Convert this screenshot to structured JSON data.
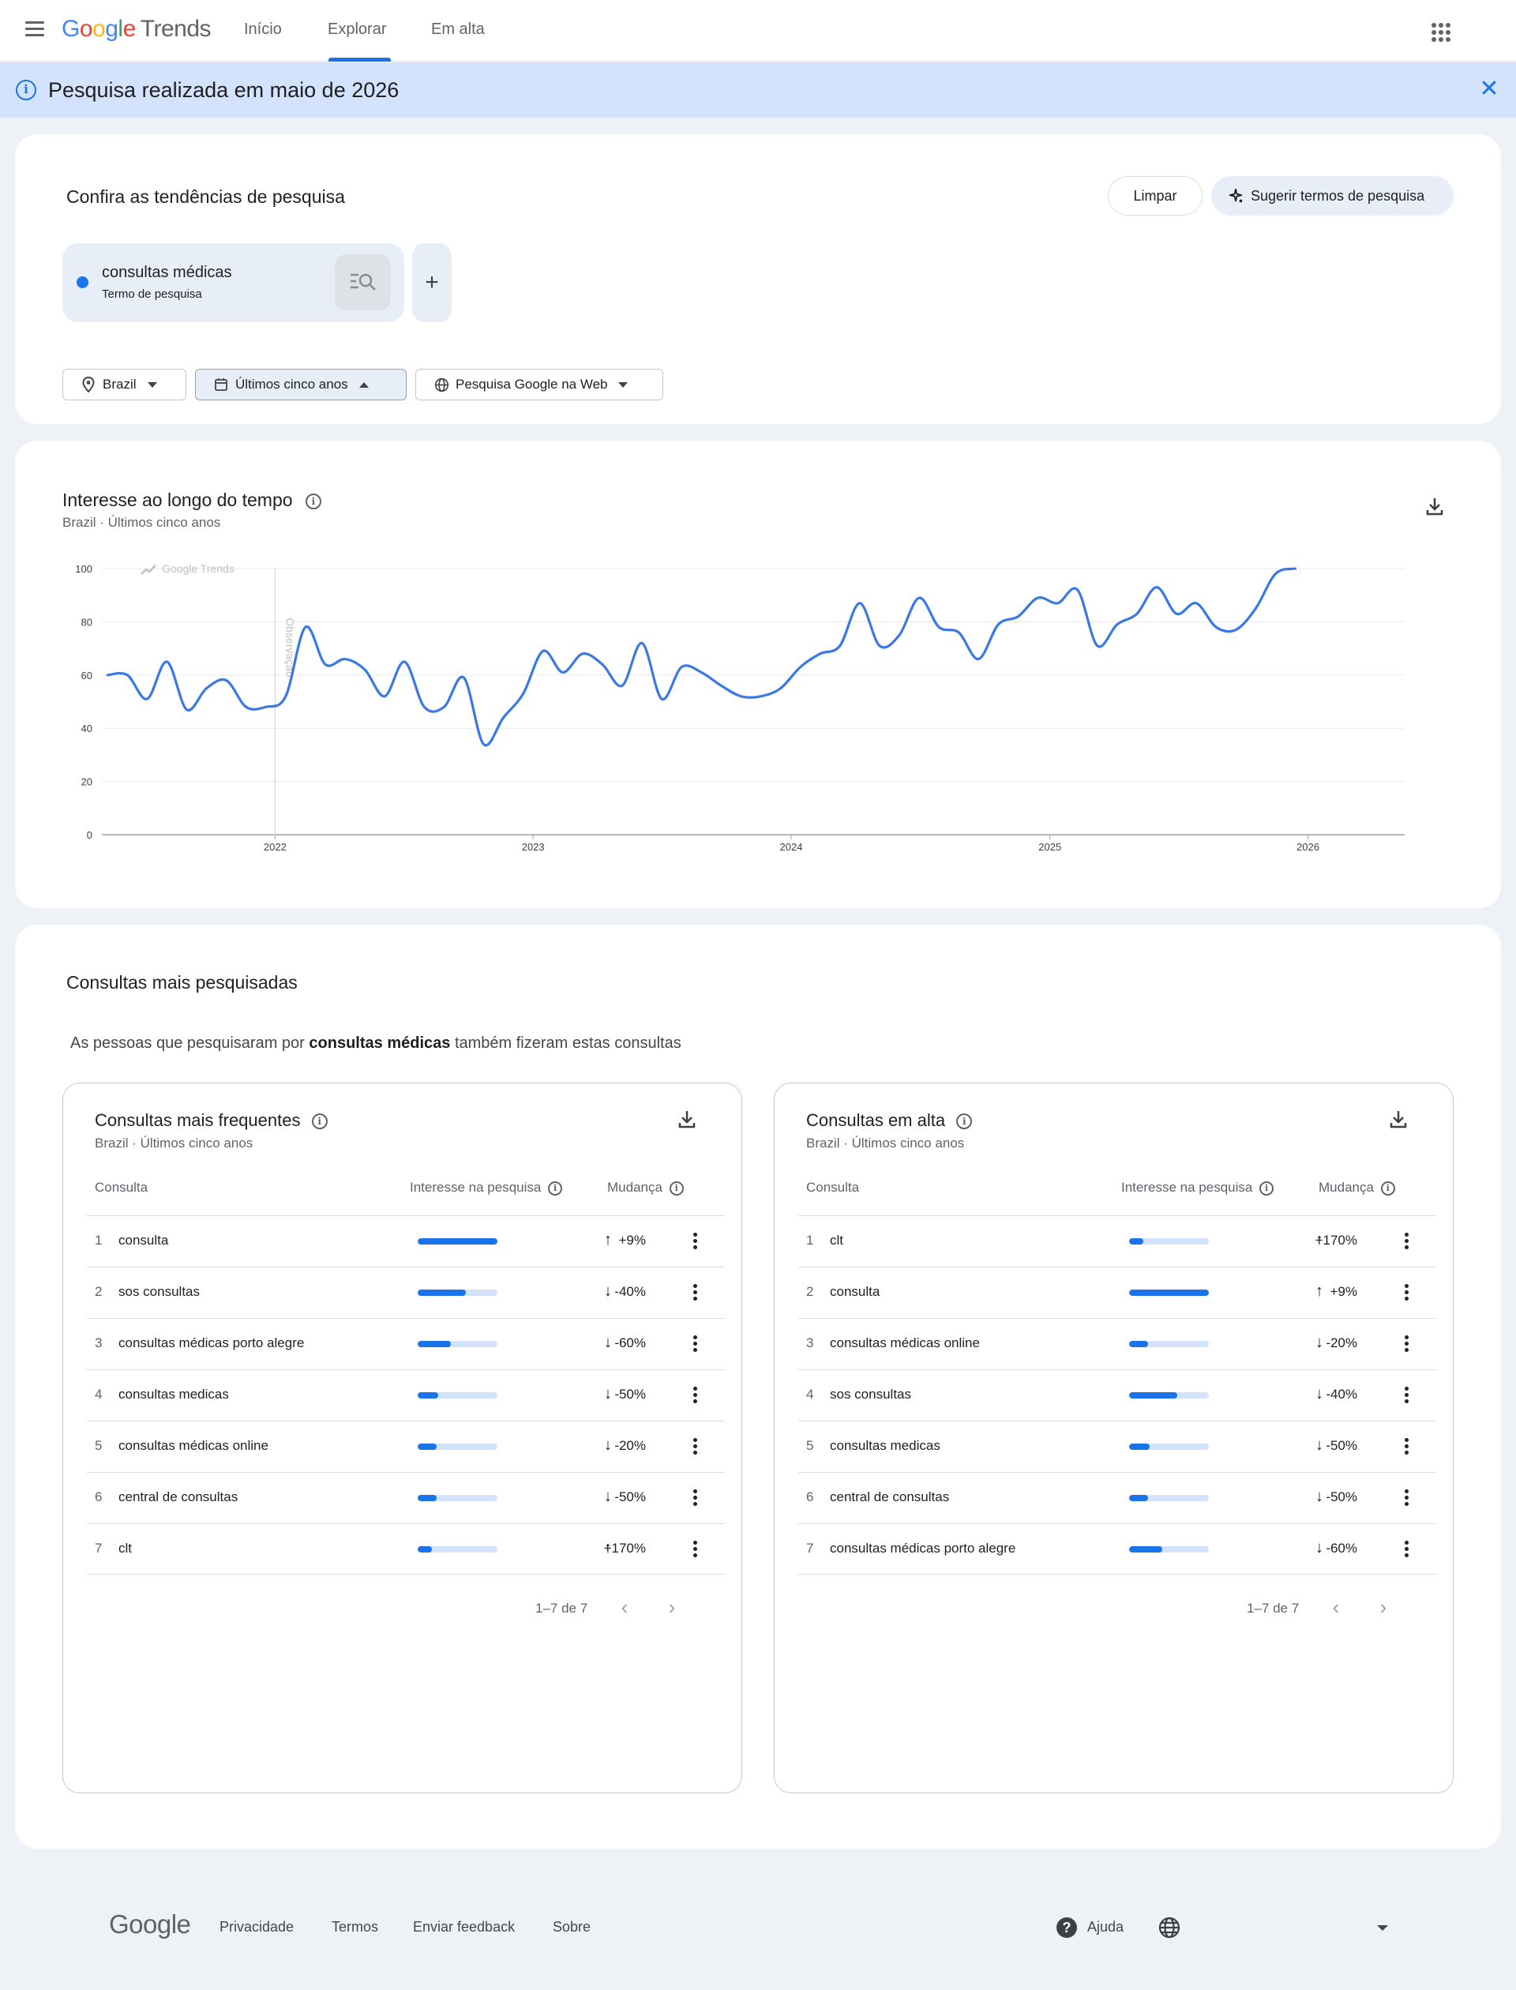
{
  "app": {
    "logo_google": [
      "G",
      "o",
      "o",
      "g",
      "l",
      "e"
    ],
    "logo_trends": "Trends",
    "nav": [
      {
        "label": "Início"
      },
      {
        "label": "Explorar"
      },
      {
        "label": "Em alta"
      }
    ]
  },
  "banner": {
    "text": "Pesquisa realizada em maio de 2026",
    "close": "✕"
  },
  "compare": {
    "title": "Confira as tendências de pesquisa",
    "clear_label": "Limpar",
    "suggest_label": "Sugerir termos de pesquisa",
    "term": {
      "name": "consultas médicas",
      "type": "Termo de pesquisa",
      "color": "#1a73e8"
    },
    "add_label": "+",
    "filters": {
      "location": "Brazil",
      "time": "Últimos cinco anos",
      "property": "Pesquisa Google na Web"
    }
  },
  "interest": {
    "title": "Interesse ao longo do tempo",
    "sub_location": "Brazil",
    "sub_time": "Últimos cinco anos",
    "watermark": "Google Trends",
    "note_label": "Observação"
  },
  "chart_data": {
    "type": "line",
    "title": "Interesse ao longo do tempo",
    "xlabel": "",
    "ylabel": "",
    "ylim": [
      0,
      100
    ],
    "yticks": [
      "0",
      "20",
      "40",
      "60",
      "80",
      "100"
    ],
    "xticks": [
      "2022",
      "2023",
      "2024",
      "2025",
      "2026"
    ],
    "xrange": [
      "2021-05",
      "2026-05"
    ],
    "grid": true,
    "series": [
      {
        "name": "consultas médicas",
        "color": "#3b78e7",
        "points": [
          [
            "2021-05-09",
            60
          ],
          [
            "2021-06-06",
            60
          ],
          [
            "2021-07-04",
            51
          ],
          [
            "2021-08-01",
            65
          ],
          [
            "2021-08-29",
            47
          ],
          [
            "2021-09-26",
            55
          ],
          [
            "2021-10-24",
            58
          ],
          [
            "2021-11-21",
            48
          ],
          [
            "2021-12-19",
            48
          ],
          [
            "2022-01-16",
            52
          ],
          [
            "2022-02-13",
            78
          ],
          [
            "2022-03-13",
            64
          ],
          [
            "2022-04-10",
            66
          ],
          [
            "2022-05-08",
            62
          ],
          [
            "2022-06-05",
            52
          ],
          [
            "2022-07-03",
            65
          ],
          [
            "2022-07-31",
            48
          ],
          [
            "2022-08-28",
            48
          ],
          [
            "2022-09-25",
            59
          ],
          [
            "2022-10-23",
            34
          ],
          [
            "2022-11-20",
            44
          ],
          [
            "2022-12-18",
            53
          ],
          [
            "2023-01-15",
            69
          ],
          [
            "2023-02-12",
            61
          ],
          [
            "2023-03-12",
            68
          ],
          [
            "2023-04-09",
            64
          ],
          [
            "2023-05-07",
            56
          ],
          [
            "2023-06-04",
            72
          ],
          [
            "2023-07-02",
            51
          ],
          [
            "2023-07-30",
            63
          ],
          [
            "2023-08-27",
            61
          ],
          [
            "2023-09-24",
            56
          ],
          [
            "2023-10-22",
            52
          ],
          [
            "2023-11-19",
            52
          ],
          [
            "2023-12-17",
            55
          ],
          [
            "2024-01-14",
            63
          ],
          [
            "2024-02-11",
            68
          ],
          [
            "2024-03-10",
            71
          ],
          [
            "2024-04-07",
            87
          ],
          [
            "2024-05-05",
            71
          ],
          [
            "2024-06-02",
            75
          ],
          [
            "2024-06-30",
            89
          ],
          [
            "2024-07-28",
            78
          ],
          [
            "2024-08-25",
            76
          ],
          [
            "2024-09-22",
            66
          ],
          [
            "2024-10-20",
            79
          ],
          [
            "2024-11-17",
            82
          ],
          [
            "2024-12-15",
            89
          ],
          [
            "2025-01-12",
            87
          ],
          [
            "2025-02-09",
            92
          ],
          [
            "2025-03-09",
            71
          ],
          [
            "2025-04-06",
            79
          ],
          [
            "2025-05-04",
            83
          ],
          [
            "2025-06-01",
            93
          ],
          [
            "2025-06-29",
            83
          ],
          [
            "2025-07-27",
            87
          ],
          [
            "2025-08-24",
            78
          ],
          [
            "2025-09-21",
            77
          ],
          [
            "2025-10-19",
            85
          ],
          [
            "2025-11-16",
            98
          ],
          [
            "2025-12-14",
            100
          ]
        ]
      }
    ]
  },
  "related": {
    "title": "Consultas mais pesquisadas",
    "desc_pre": "As pessoas que pesquisaram por",
    "desc_term": "consultas médicas",
    "desc_post": "também fizeram estas consultas",
    "panels": [
      {
        "title": "Consultas mais frequentes",
        "sub_location": "Brazil",
        "sub_time": "Últimos cinco anos",
        "col_query": "Consulta",
        "col_interest": "Interesse na pesquisa",
        "col_change": "Mudança",
        "pager": "1–7 de 7",
        "rows": [
          {
            "rank": "1",
            "query": "consulta",
            "interest": 100,
            "direction": "up",
            "change": "+9%"
          },
          {
            "rank": "2",
            "query": "sos consultas",
            "interest": 60,
            "direction": "down",
            "change": "-40%"
          },
          {
            "rank": "3",
            "query": "consultas médicas porto alegre",
            "interest": 42,
            "direction": "down",
            "change": "-60%"
          },
          {
            "rank": "4",
            "query": "consultas medicas",
            "interest": 26,
            "direction": "down",
            "change": "-50%"
          },
          {
            "rank": "5",
            "query": "consultas médicas online",
            "interest": 24,
            "direction": "down",
            "change": "-20%"
          },
          {
            "rank": "6",
            "query": "central de consultas",
            "interest": 24,
            "direction": "down",
            "change": "-50%"
          },
          {
            "rank": "7",
            "query": "clt",
            "interest": 18,
            "direction": "up",
            "change": "+170%"
          }
        ]
      },
      {
        "title": "Consultas em alta",
        "sub_location": "Brazil",
        "sub_time": "Últimos cinco anos",
        "col_query": "Consulta",
        "col_interest": "Interesse na pesquisa",
        "col_change": "Mudança",
        "pager": "1–7 de 7",
        "rows": [
          {
            "rank": "1",
            "query": "clt",
            "interest": 18,
            "direction": "up",
            "change": "+170%"
          },
          {
            "rank": "2",
            "query": "consulta",
            "interest": 100,
            "direction": "up",
            "change": "+9%"
          },
          {
            "rank": "3",
            "query": "consultas médicas online",
            "interest": 24,
            "direction": "down",
            "change": "-20%"
          },
          {
            "rank": "4",
            "query": "sos consultas",
            "interest": 60,
            "direction": "down",
            "change": "-40%"
          },
          {
            "rank": "5",
            "query": "consultas medicas",
            "interest": 26,
            "direction": "down",
            "change": "-50%"
          },
          {
            "rank": "6",
            "query": "central de consultas",
            "interest": 24,
            "direction": "down",
            "change": "-50%"
          },
          {
            "rank": "7",
            "query": "consultas médicas porto alegre",
            "interest": 42,
            "direction": "down",
            "change": "-60%"
          }
        ]
      }
    ]
  },
  "footer": {
    "logo": "Google",
    "links": [
      "Privacidade",
      "Termos",
      "Enviar feedback",
      "Sobre"
    ],
    "help": "Ajuda"
  }
}
